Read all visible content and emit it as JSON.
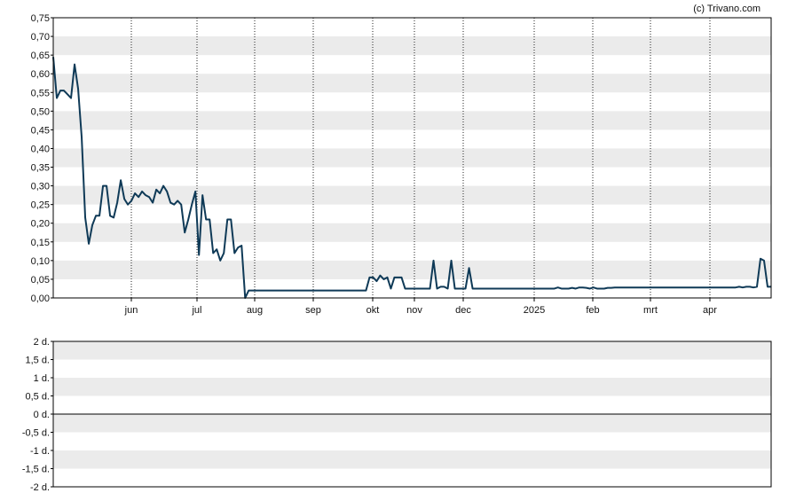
{
  "credit": "(c) Trivano.com",
  "colors": {
    "line": "#0f3a57",
    "band": "#ebebeb",
    "frame": "#000000",
    "grid": "#222222"
  },
  "chart_data": [
    {
      "type": "line",
      "ylim": [
        0,
        0.75
      ],
      "y_ticks": [
        "0,00",
        "0,05",
        "0,10",
        "0,15",
        "0,20",
        "0,25",
        "0,30",
        "0,35",
        "0,40",
        "0,45",
        "0,50",
        "0,55",
        "0,60",
        "0,65",
        "0,70",
        "0,75"
      ],
      "x_ticks": [
        "jun",
        "jul",
        "aug",
        "sep",
        "okt",
        "nov",
        "dec",
        "2025",
        "feb",
        "mrt",
        "apr"
      ],
      "series": [
        {
          "values": [
            0.645,
            0.535,
            0.555,
            0.555,
            0.545,
            0.535,
            0.625,
            0.56,
            0.43,
            0.215,
            0.145,
            0.195,
            0.22,
            0.22,
            0.3,
            0.3,
            0.22,
            0.215,
            0.255,
            0.315,
            0.265,
            0.25,
            0.26,
            0.28,
            0.27,
            0.285,
            0.275,
            0.27,
            0.255,
            0.29,
            0.28,
            0.3,
            0.285,
            0.255,
            0.25,
            0.26,
            0.25,
            0.175,
            0.21,
            0.25,
            0.285,
            0.115,
            0.275,
            0.21,
            0.21,
            0.12,
            0.13,
            0.1,
            0.12,
            0.21,
            0.21,
            0.12,
            0.135,
            0.14,
            0.0,
            0.02,
            0.02,
            0.02,
            0.02,
            0.02,
            0.02,
            0.02,
            0.02,
            0.02,
            0.02,
            0.02,
            0.02,
            0.02,
            0.02,
            0.02,
            0.02,
            0.02,
            0.02,
            0.02,
            0.02,
            0.02,
            0.02,
            0.02,
            0.02,
            0.02,
            0.02,
            0.02,
            0.02,
            0.02,
            0.02,
            0.02,
            0.02,
            0.02,
            0.02,
            0.055,
            0.055,
            0.045,
            0.06,
            0.05,
            0.055,
            0.025,
            0.055,
            0.055,
            0.055,
            0.025,
            0.025,
            0.025,
            0.025,
            0.025,
            0.025,
            0.025,
            0.025,
            0.1,
            0.025,
            0.03,
            0.03,
            0.025,
            0.1,
            0.025,
            0.025,
            0.025,
            0.025,
            0.08,
            0.025,
            0.025,
            0.025,
            0.025,
            0.025,
            0.025,
            0.025,
            0.025,
            0.025,
            0.025,
            0.025,
            0.025,
            0.025,
            0.025,
            0.025,
            0.025,
            0.025,
            0.025,
            0.025,
            0.025,
            0.025,
            0.025,
            0.025,
            0.025,
            0.028,
            0.025,
            0.025,
            0.025,
            0.027,
            0.025,
            0.028,
            0.028,
            0.027,
            0.025,
            0.028,
            0.025,
            0.025,
            0.025,
            0.027,
            0.027,
            0.028,
            0.028,
            0.028,
            0.028,
            0.028,
            0.028,
            0.028,
            0.028,
            0.028,
            0.028,
            0.028,
            0.028,
            0.028,
            0.028,
            0.028,
            0.028,
            0.028,
            0.028,
            0.028,
            0.028,
            0.028,
            0.028,
            0.028,
            0.028,
            0.028,
            0.028,
            0.028,
            0.028,
            0.028,
            0.028,
            0.028,
            0.028,
            0.028,
            0.028,
            0.028,
            0.03,
            0.028,
            0.03,
            0.03,
            0.028,
            0.03,
            0.105,
            0.1,
            0.03,
            0.03
          ]
        }
      ]
    },
    {
      "type": "bar",
      "ylim": [
        -2,
        2
      ],
      "y_ticks": [
        "2 d.",
        "1,5 d.",
        "1 d.",
        "0,5 d.",
        "0 d.",
        "-0,5 d.",
        "-1 d.",
        "-1,5 d.",
        "-2 d."
      ],
      "values": []
    }
  ]
}
